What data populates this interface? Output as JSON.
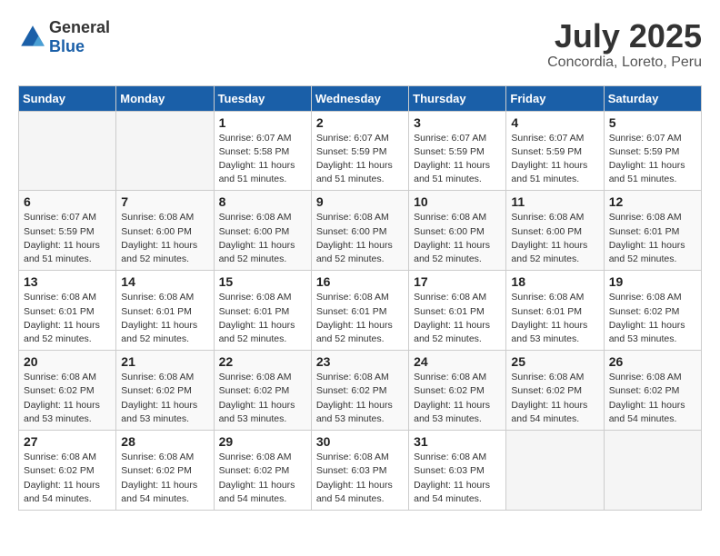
{
  "logo": {
    "general": "General",
    "blue": "Blue"
  },
  "title": "July 2025",
  "subtitle": "Concordia, Loreto, Peru",
  "days_of_week": [
    "Sunday",
    "Monday",
    "Tuesday",
    "Wednesday",
    "Thursday",
    "Friday",
    "Saturday"
  ],
  "weeks": [
    [
      {
        "day": "",
        "info": ""
      },
      {
        "day": "",
        "info": ""
      },
      {
        "day": "1",
        "info": "Sunrise: 6:07 AM\nSunset: 5:58 PM\nDaylight: 11 hours and 51 minutes."
      },
      {
        "day": "2",
        "info": "Sunrise: 6:07 AM\nSunset: 5:59 PM\nDaylight: 11 hours and 51 minutes."
      },
      {
        "day": "3",
        "info": "Sunrise: 6:07 AM\nSunset: 5:59 PM\nDaylight: 11 hours and 51 minutes."
      },
      {
        "day": "4",
        "info": "Sunrise: 6:07 AM\nSunset: 5:59 PM\nDaylight: 11 hours and 51 minutes."
      },
      {
        "day": "5",
        "info": "Sunrise: 6:07 AM\nSunset: 5:59 PM\nDaylight: 11 hours and 51 minutes."
      }
    ],
    [
      {
        "day": "6",
        "info": "Sunrise: 6:07 AM\nSunset: 5:59 PM\nDaylight: 11 hours and 51 minutes."
      },
      {
        "day": "7",
        "info": "Sunrise: 6:08 AM\nSunset: 6:00 PM\nDaylight: 11 hours and 52 minutes."
      },
      {
        "day": "8",
        "info": "Sunrise: 6:08 AM\nSunset: 6:00 PM\nDaylight: 11 hours and 52 minutes."
      },
      {
        "day": "9",
        "info": "Sunrise: 6:08 AM\nSunset: 6:00 PM\nDaylight: 11 hours and 52 minutes."
      },
      {
        "day": "10",
        "info": "Sunrise: 6:08 AM\nSunset: 6:00 PM\nDaylight: 11 hours and 52 minutes."
      },
      {
        "day": "11",
        "info": "Sunrise: 6:08 AM\nSunset: 6:00 PM\nDaylight: 11 hours and 52 minutes."
      },
      {
        "day": "12",
        "info": "Sunrise: 6:08 AM\nSunset: 6:01 PM\nDaylight: 11 hours and 52 minutes."
      }
    ],
    [
      {
        "day": "13",
        "info": "Sunrise: 6:08 AM\nSunset: 6:01 PM\nDaylight: 11 hours and 52 minutes."
      },
      {
        "day": "14",
        "info": "Sunrise: 6:08 AM\nSunset: 6:01 PM\nDaylight: 11 hours and 52 minutes."
      },
      {
        "day": "15",
        "info": "Sunrise: 6:08 AM\nSunset: 6:01 PM\nDaylight: 11 hours and 52 minutes."
      },
      {
        "day": "16",
        "info": "Sunrise: 6:08 AM\nSunset: 6:01 PM\nDaylight: 11 hours and 52 minutes."
      },
      {
        "day": "17",
        "info": "Sunrise: 6:08 AM\nSunset: 6:01 PM\nDaylight: 11 hours and 52 minutes."
      },
      {
        "day": "18",
        "info": "Sunrise: 6:08 AM\nSunset: 6:01 PM\nDaylight: 11 hours and 53 minutes."
      },
      {
        "day": "19",
        "info": "Sunrise: 6:08 AM\nSunset: 6:02 PM\nDaylight: 11 hours and 53 minutes."
      }
    ],
    [
      {
        "day": "20",
        "info": "Sunrise: 6:08 AM\nSunset: 6:02 PM\nDaylight: 11 hours and 53 minutes."
      },
      {
        "day": "21",
        "info": "Sunrise: 6:08 AM\nSunset: 6:02 PM\nDaylight: 11 hours and 53 minutes."
      },
      {
        "day": "22",
        "info": "Sunrise: 6:08 AM\nSunset: 6:02 PM\nDaylight: 11 hours and 53 minutes."
      },
      {
        "day": "23",
        "info": "Sunrise: 6:08 AM\nSunset: 6:02 PM\nDaylight: 11 hours and 53 minutes."
      },
      {
        "day": "24",
        "info": "Sunrise: 6:08 AM\nSunset: 6:02 PM\nDaylight: 11 hours and 53 minutes."
      },
      {
        "day": "25",
        "info": "Sunrise: 6:08 AM\nSunset: 6:02 PM\nDaylight: 11 hours and 54 minutes."
      },
      {
        "day": "26",
        "info": "Sunrise: 6:08 AM\nSunset: 6:02 PM\nDaylight: 11 hours and 54 minutes."
      }
    ],
    [
      {
        "day": "27",
        "info": "Sunrise: 6:08 AM\nSunset: 6:02 PM\nDaylight: 11 hours and 54 minutes."
      },
      {
        "day": "28",
        "info": "Sunrise: 6:08 AM\nSunset: 6:02 PM\nDaylight: 11 hours and 54 minutes."
      },
      {
        "day": "29",
        "info": "Sunrise: 6:08 AM\nSunset: 6:02 PM\nDaylight: 11 hours and 54 minutes."
      },
      {
        "day": "30",
        "info": "Sunrise: 6:08 AM\nSunset: 6:03 PM\nDaylight: 11 hours and 54 minutes."
      },
      {
        "day": "31",
        "info": "Sunrise: 6:08 AM\nSunset: 6:03 PM\nDaylight: 11 hours and 54 minutes."
      },
      {
        "day": "",
        "info": ""
      },
      {
        "day": "",
        "info": ""
      }
    ]
  ]
}
